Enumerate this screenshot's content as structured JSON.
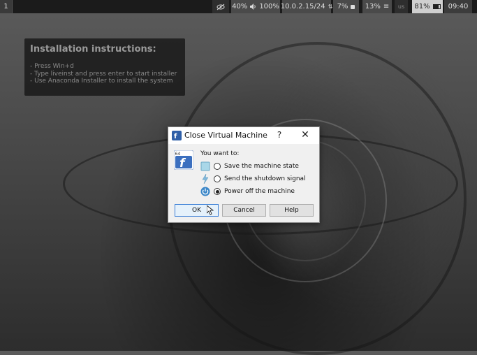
{
  "topbar": {
    "workspace": "1",
    "volume_percent": "40%",
    "speaker_level": "100%",
    "ip": "10.0.2.15/24",
    "cpu": "7%",
    "memory": "13%",
    "keyboard": "us",
    "battery": "81%",
    "time": "09:40"
  },
  "instructions": {
    "title": "Installation instructions:",
    "line1": "- Press   Win+d",
    "line2": "- Type   liveinst   and press enter to start installer",
    "line3": "- Use Anaconda Installer to install the system"
  },
  "dialog": {
    "title": "Close Virtual Machine",
    "help_glyph": "?",
    "close_glyph": "✕",
    "prompt": "You want to:",
    "options": [
      {
        "label": "Save the machine state",
        "selected": false
      },
      {
        "label": "Send the shutdown signal",
        "selected": false
      },
      {
        "label": "Power off the machine",
        "selected": true
      }
    ],
    "buttons": {
      "ok": "OK",
      "cancel": "Cancel",
      "help": "Help"
    }
  },
  "colors": {
    "accent_blue": "#3c7fd6",
    "dialog_bg": "#f0f0f0",
    "topbar_bg": "#1b1b1b"
  }
}
